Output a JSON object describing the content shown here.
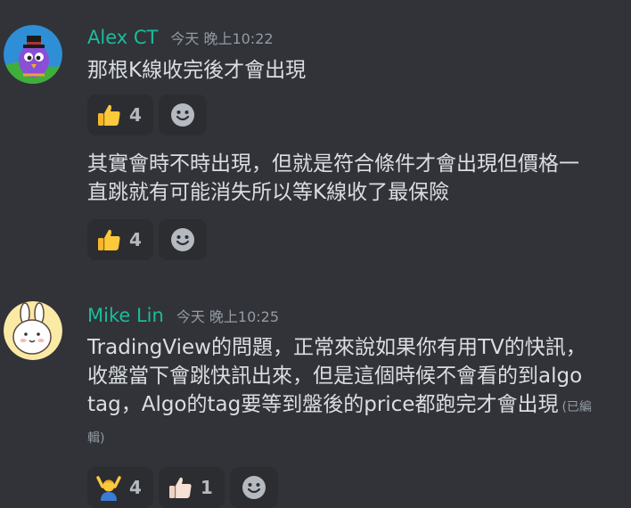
{
  "messages": [
    {
      "username": "Alex CT",
      "timestamp": "今天 晚上10:22",
      "avatar_icon": "purple-bird-top-hat",
      "username_color": "#1abc9c",
      "lines": [
        {
          "text": "那根K線收完後才會出現",
          "reactions": [
            {
              "emoji": "thumbs-up-icon",
              "count": "4"
            }
          ]
        },
        {
          "text": "其實會時不時出現，但就是符合條件才會出現但價格一直跳就有可能消失所以等K線收了最保險",
          "reactions": [
            {
              "emoji": "thumbs-up-icon",
              "count": "4"
            }
          ]
        }
      ]
    },
    {
      "username": "Mike Lin",
      "timestamp": "今天 晚上10:25",
      "avatar_icon": "bunny-cartoon",
      "username_color": "#1abc9c",
      "lines": [
        {
          "text": "TradingView的問題，正常來說如果你有用TV的快訊，收盤當下會跳快訊出來，但是這個時候不會看的到algo tag，Algo的tag要等到盤後的price都跑完才會出現",
          "edited": "(已編輯)",
          "reactions": [
            {
              "emoji": "person-raising-hands-icon",
              "count": "4"
            },
            {
              "emoji": "thumbs-up-light-icon",
              "count": "1"
            }
          ]
        }
      ]
    }
  ],
  "colors": {
    "background": "#313338",
    "reaction_bg": "#2b2d31",
    "text": "#dbdee1",
    "muted": "#949ba4"
  }
}
